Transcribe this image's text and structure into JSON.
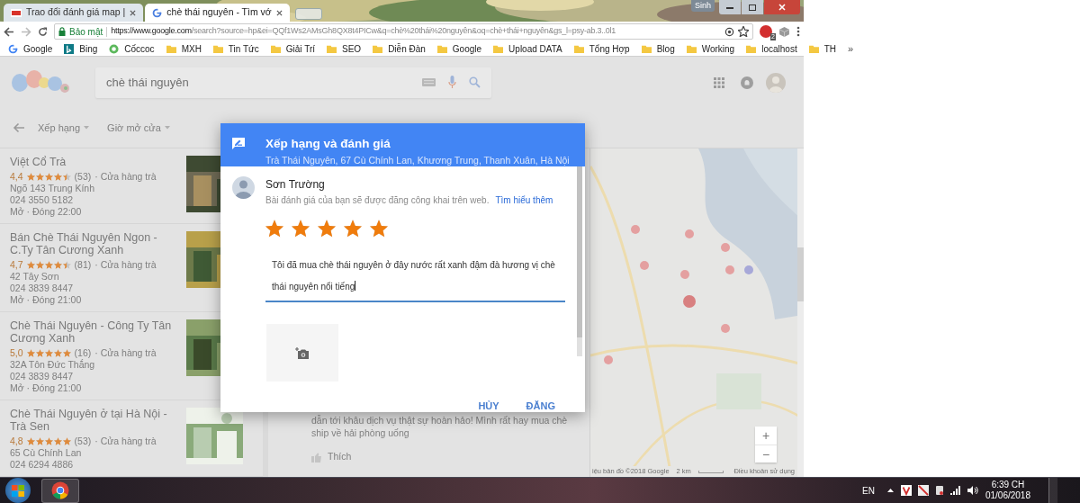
{
  "browser": {
    "tabs": [
      {
        "title": "Trao đổi đánh giá map |",
        "selected": false
      },
      {
        "title": "chè thái nguyên - Tìm vớ",
        "selected": true
      }
    ],
    "user_label": "Sinh",
    "security_label": "Bảo mật",
    "url_host": "https://www.google.com",
    "url_rest": "/search?source=hp&ei=QQf1Ws2AMsGh8QX8t4PICw&q=chè%20thái%20nguyên&oq=chè+thái+nguyên&gs_l=psy-ab.3..0l1",
    "extension_badge": "2",
    "bookmarks": [
      {
        "label": "Google",
        "kind": "google"
      },
      {
        "label": "Bing",
        "kind": "bing"
      },
      {
        "label": "Cốccoc",
        "kind": "coccoc"
      },
      {
        "label": "MXH",
        "kind": "folder"
      },
      {
        "label": "Tin Tức",
        "kind": "folder"
      },
      {
        "label": "Giải Trí",
        "kind": "folder"
      },
      {
        "label": "SEO",
        "kind": "folder"
      },
      {
        "label": "Diễn Đàn",
        "kind": "folder"
      },
      {
        "label": "Google",
        "kind": "folder"
      },
      {
        "label": "Upload DATA",
        "kind": "folder"
      },
      {
        "label": "Tổng Hợp",
        "kind": "folder"
      },
      {
        "label": "Blog",
        "kind": "folder"
      },
      {
        "label": "Working",
        "kind": "folder"
      },
      {
        "label": "localhost",
        "kind": "folder"
      },
      {
        "label": "TH",
        "kind": "folder"
      }
    ],
    "bookmarks_overflow": "»"
  },
  "page": {
    "search_query": "chè thái nguyên",
    "filters": [
      "Xếp hạng",
      "Giờ mở cửa"
    ],
    "places": [
      {
        "name": "Việt Cổ Trà",
        "rating": "4,4",
        "stars": 4.5,
        "count": "(53)",
        "category": "· Cửa hàng trà",
        "address": "Ngõ 143 Trung Kính",
        "phone": "024 3550 5182",
        "hours": "Mở · Đóng 22:00"
      },
      {
        "name": "Bán Chè Thái Nguyên Ngon - C.Ty Tân Cương Xanh",
        "rating": "4,7",
        "stars": 4.5,
        "count": "(81)",
        "category": "· Cửa hàng trà",
        "address": "42 Tây Sơn",
        "phone": "024 3839 8447",
        "hours": "Mở · Đóng 21:00"
      },
      {
        "name": "Chè Thái Nguyên - Công Ty Tân Cương Xanh",
        "rating": "5,0",
        "stars": 5,
        "count": "(16)",
        "category": "· Cửa hàng trà",
        "address": "32A Tôn Đức Thắng",
        "phone": "024 3839 8447",
        "hours": "Mở · Đóng 21:00"
      },
      {
        "name": "Chè Thái Nguyên ở tại Hà Nội - Trà Sen",
        "rating": "4,8",
        "stars": 5,
        "count": "(53)",
        "category": "· Cửa hàng trà",
        "address": "65 Cù Chính Lan",
        "phone": "024 6294 4886"
      }
    ],
    "review_text": "dẫn tới khâu dịch vụ thật sự hoàn hảo! Mình rất hay mua chè ship về hải phòng uống",
    "like_label": "Thích",
    "map_zoom": [
      "+",
      "−"
    ],
    "map_attribution": "iệu bản đồ ©2018 Google",
    "map_scale": "2 km",
    "map_terms": "Điều khoản sử dụng"
  },
  "dialog": {
    "title": "Xếp hạng và đánh giá",
    "subtitle": "Trà Thái Nguyên, 67 Cù Chính Lan, Khương Trung, Thanh Xuân, Hà Nội",
    "user_name": "Sơn Trường",
    "notice": "Bài đánh giá của bạn sẽ được đăng công khai trên web.",
    "learn_more": "Tìm hiểu thêm",
    "stars": 5,
    "review": "Tôi đã mua chè thái nguyên ở đây nước rất xanh đậm đà hương vị chè thái nguyên nổi tiếng",
    "buttons": [
      "HỦY",
      "ĐĂNG"
    ]
  },
  "taskbar": {
    "language": "EN",
    "time": "6:39 CH",
    "date": "01/06/2018"
  }
}
